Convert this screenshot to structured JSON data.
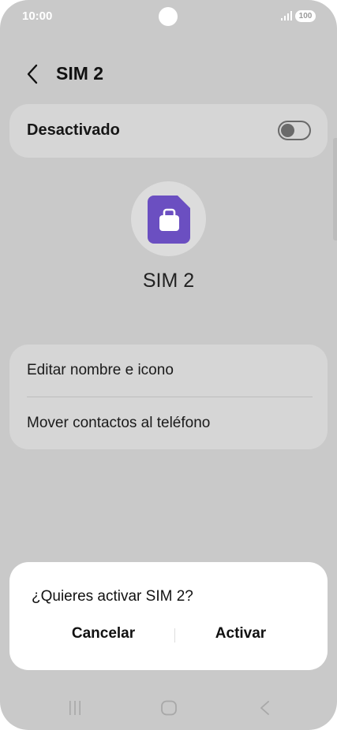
{
  "status_bar": {
    "time": "10:00",
    "battery": "100"
  },
  "header": {
    "title": "SIM 2",
    "back_icon": "chevron-left-icon"
  },
  "toggle": {
    "label": "Desactivado",
    "state": "off"
  },
  "sim": {
    "name": "SIM 2",
    "icon": "briefcase-sim-icon",
    "icon_color": "#6b4fc1"
  },
  "menu": {
    "items": [
      {
        "label": "Editar nombre e icono"
      },
      {
        "label": "Mover contactos al teléfono"
      }
    ]
  },
  "dialog": {
    "title": "¿Quieres activar SIM 2?",
    "cancel_label": "Cancelar",
    "confirm_label": "Activar"
  },
  "nav": {
    "recents_icon": "recents-icon",
    "home_icon": "home-icon",
    "back_icon": "back-icon"
  }
}
